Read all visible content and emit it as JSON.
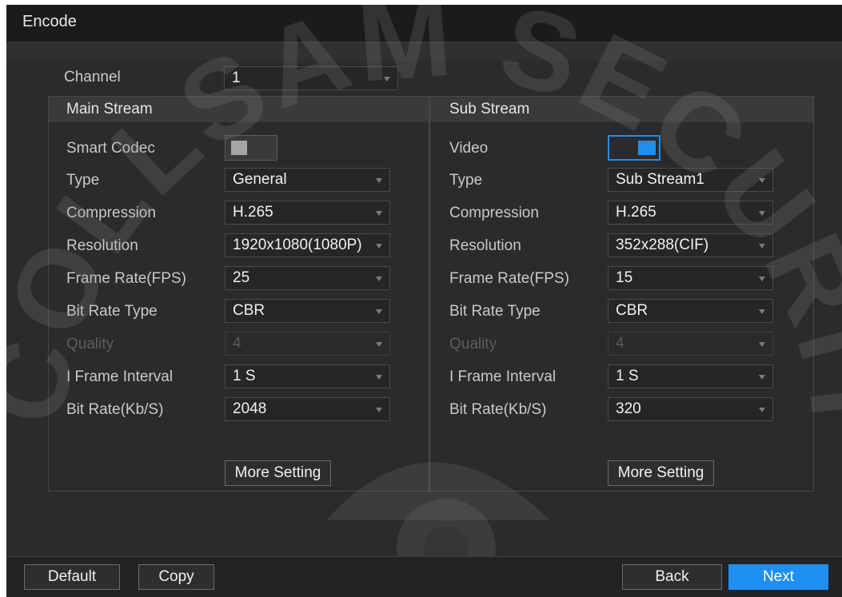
{
  "window": {
    "title": "Encode"
  },
  "channel": {
    "label": "Channel",
    "value": "1"
  },
  "main_stream": {
    "title": "Main Stream",
    "smart_codec": {
      "label": "Smart Codec",
      "state": "off"
    },
    "type": {
      "label": "Type",
      "value": "General"
    },
    "compression": {
      "label": "Compression",
      "value": "H.265"
    },
    "resolution": {
      "label": "Resolution",
      "value": "1920x1080(1080P)"
    },
    "frame_rate": {
      "label": "Frame Rate(FPS)",
      "value": "25"
    },
    "bit_rate_type": {
      "label": "Bit Rate Type",
      "value": "CBR"
    },
    "quality": {
      "label": "Quality",
      "value": "4"
    },
    "i_frame_interval": {
      "label": "I Frame Interval",
      "value": "1 S"
    },
    "bit_rate": {
      "label": "Bit Rate(Kb/S)",
      "value": "2048"
    },
    "more_setting": "More Setting"
  },
  "sub_stream": {
    "title": "Sub Stream",
    "video": {
      "label": "Video",
      "state": "on"
    },
    "type": {
      "label": "Type",
      "value": "Sub Stream1"
    },
    "compression": {
      "label": "Compression",
      "value": "H.265"
    },
    "resolution": {
      "label": "Resolution",
      "value": "352x288(CIF)"
    },
    "frame_rate": {
      "label": "Frame Rate(FPS)",
      "value": "15"
    },
    "bit_rate_type": {
      "label": "Bit Rate Type",
      "value": "CBR"
    },
    "quality": {
      "label": "Quality",
      "value": "4"
    },
    "i_frame_interval": {
      "label": "I Frame Interval",
      "value": "1 S"
    },
    "bit_rate": {
      "label": "Bit Rate(Kb/S)",
      "value": "320"
    },
    "more_setting": "More Setting"
  },
  "footer": {
    "default": "Default",
    "copy": "Copy",
    "back": "Back",
    "next": "Next"
  },
  "watermark": {
    "text": "COLLSAM SECURITY"
  },
  "colors": {
    "accent": "#1e8ff0",
    "background": "#2b2b2d",
    "title_bar": "#1b1b1d"
  }
}
